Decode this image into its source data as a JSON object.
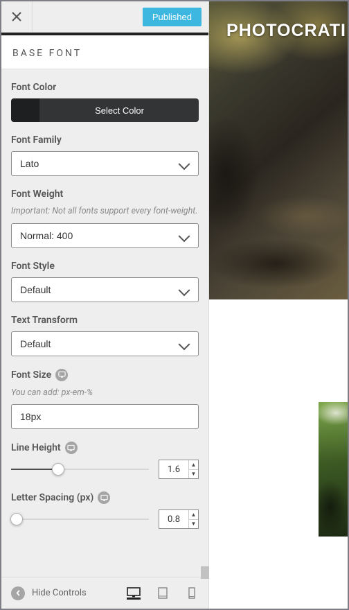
{
  "toolbar": {
    "publish_label": "Published"
  },
  "section_title": "BASE FONT",
  "font_color": {
    "label": "Font Color",
    "button_label": "Select Color"
  },
  "font_family": {
    "label": "Font Family",
    "value": "Lato"
  },
  "font_weight": {
    "label": "Font Weight",
    "note": "Important: Not all fonts support every font-weight.",
    "value": "Normal: 400"
  },
  "font_style": {
    "label": "Font Style",
    "value": "Default"
  },
  "text_transform": {
    "label": "Text Transform",
    "value": "Default"
  },
  "font_size": {
    "label": "Font Size",
    "hint": "You can add: px-em-%",
    "value": "18px"
  },
  "line_height": {
    "label": "Line Height",
    "value": "1.6",
    "pct": 34
  },
  "letter_spacing": {
    "label": "Letter Spacing (px)",
    "value": "0.8",
    "pct": 4
  },
  "footer": {
    "hide_label": "Hide Controls"
  },
  "preview": {
    "brand": "PHOTOCRATI"
  }
}
